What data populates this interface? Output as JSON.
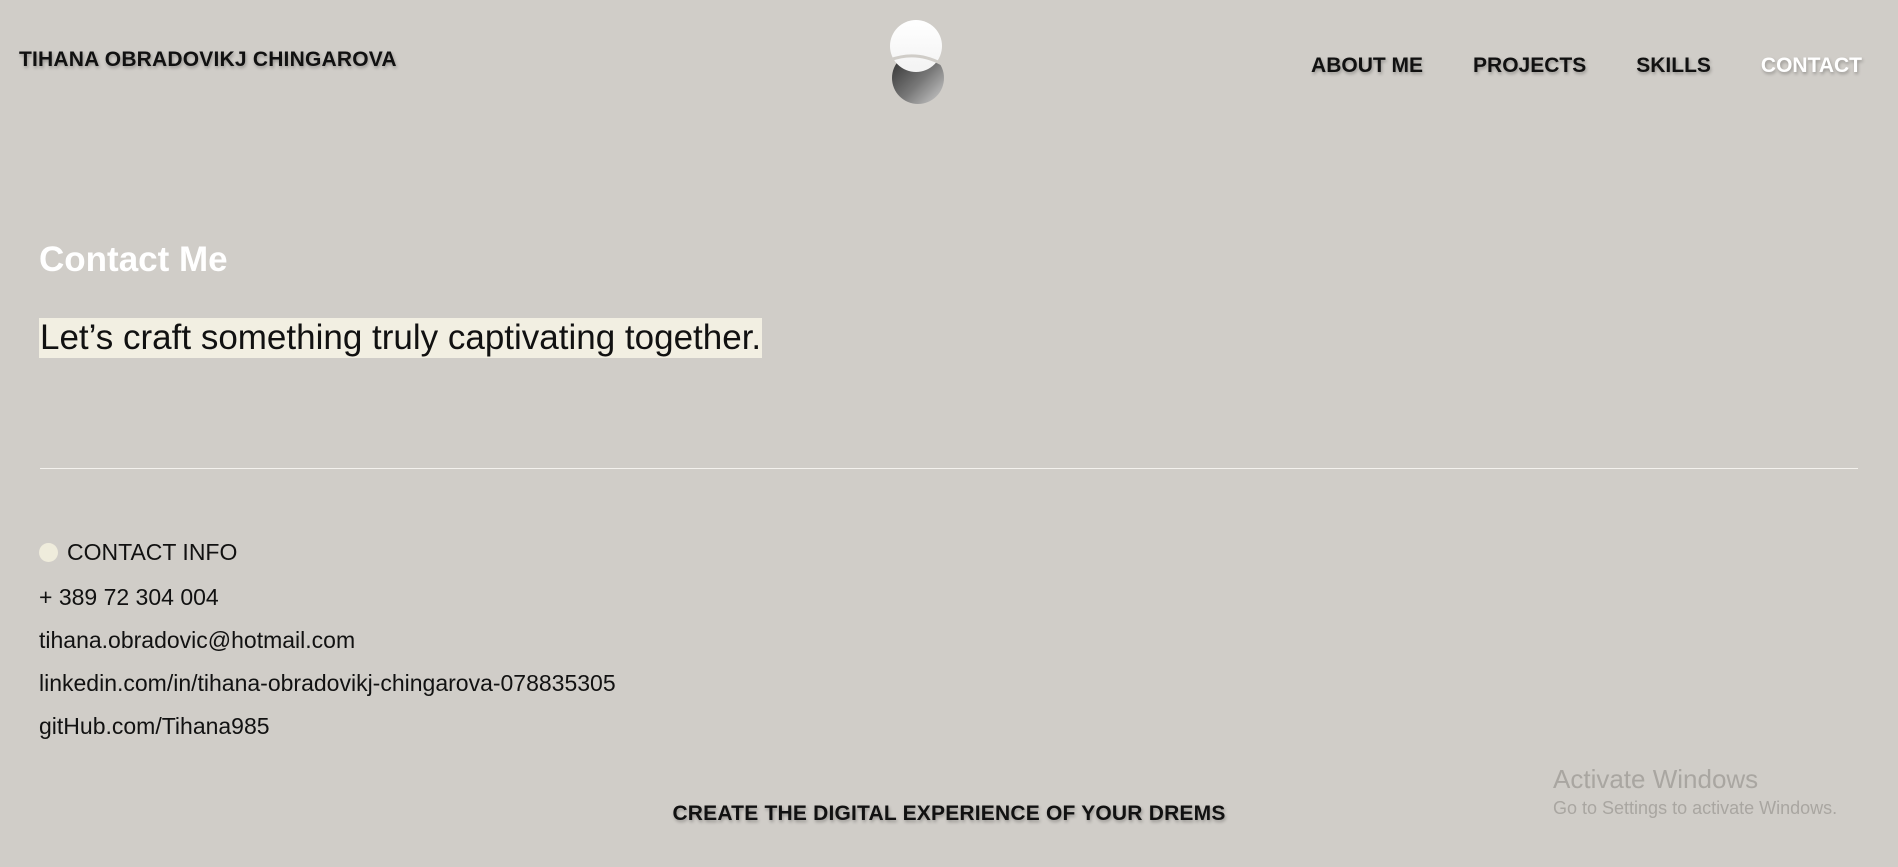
{
  "header": {
    "site_name": "TIHANA OBRADOVIKJ CHINGAROVA",
    "logo_icon": "s-gradient-logo-icon",
    "nav": [
      {
        "label": "ABOUT ME",
        "active": false
      },
      {
        "label": "PROJECTS",
        "active": false
      },
      {
        "label": "SKILLS",
        "active": false
      },
      {
        "label": "CONTACT",
        "active": true
      }
    ]
  },
  "main": {
    "heading": "Contact Me",
    "tagline": "Let’s craft something truly captivating together.",
    "contact_info": {
      "label": "CONTACT INFO",
      "phone": "+ 389 72 304 004",
      "email": "tihana.obradovic@hotmail.com",
      "linkedin": "linkedin.com/in/tihana-obradovikj-chingarova-078835305",
      "github": "gitHub.com/Tihana985"
    }
  },
  "footer": {
    "tagline": "CREATE THE DIGITAL EXPERIENCE OF YOUR DREMS"
  },
  "os_overlay": {
    "title": "Activate Windows",
    "subtitle": "Go to Settings to activate Windows."
  },
  "colors": {
    "background": "#d0cdc8",
    "highlight": "#f2efe2",
    "active_nav": "#ffffff",
    "text": "#111111"
  }
}
